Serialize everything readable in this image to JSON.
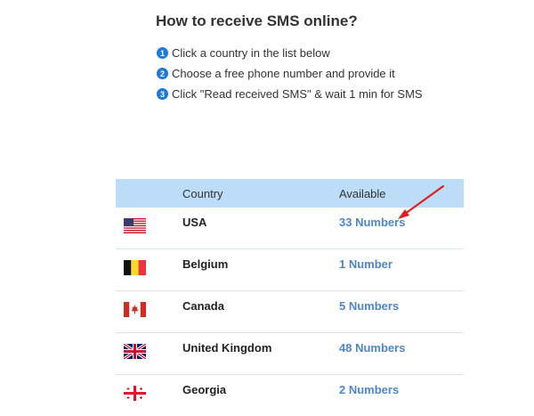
{
  "heading": "How to receive SMS online?",
  "steps": [
    {
      "num": "1",
      "text": "Click a country in the list below"
    },
    {
      "num": "2",
      "text": "Choose a free phone number and provide it"
    },
    {
      "num": "3",
      "text": "Click \"Read received SMS\" & wait 1 min for SMS"
    }
  ],
  "table": {
    "headers": {
      "country": "Country",
      "available": "Available"
    },
    "rows": [
      {
        "flag": "usa-flag",
        "country": "USA",
        "available": "33 Numbers"
      },
      {
        "flag": "belgium-flag",
        "country": "Belgium",
        "available": "1 Number"
      },
      {
        "flag": "canada-flag",
        "country": "Canada",
        "available": "5 Numbers"
      },
      {
        "flag": "uk-flag",
        "country": "United Kingdom",
        "available": "48 Numbers"
      },
      {
        "flag": "georgia-flag",
        "country": "Georgia",
        "available": "2 Numbers"
      }
    ]
  },
  "colors": {
    "header_bg": "#bcdcf8",
    "link": "#4f86c6",
    "step_badge": "#1e7ad6",
    "annotation_arrow": "#e02020"
  }
}
